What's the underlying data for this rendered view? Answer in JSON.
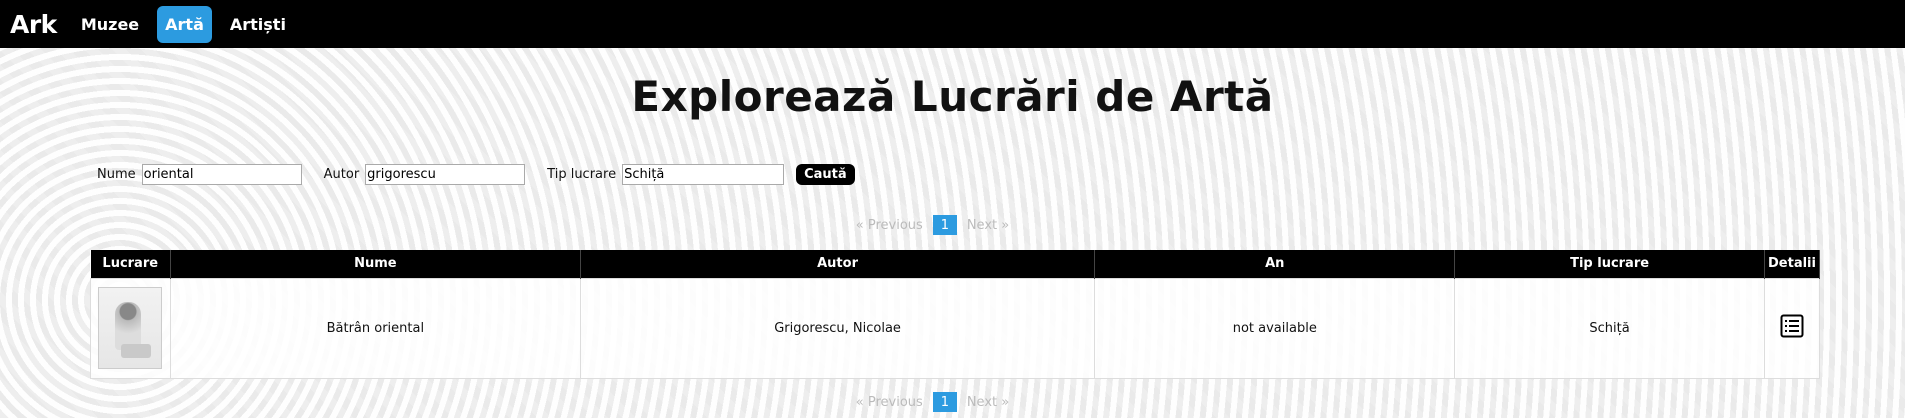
{
  "nav": {
    "brand": "Ark",
    "items": [
      {
        "label": "Muzee",
        "active": false
      },
      {
        "label": "Artă",
        "active": true
      },
      {
        "label": "Artiști",
        "active": false
      }
    ]
  },
  "page": {
    "title": "Explorează Lucrări de Artă"
  },
  "filters": {
    "name_label": "Nume",
    "name_value": "oriental",
    "author_label": "Autor",
    "author_value": "grigorescu",
    "type_label": "Tip lucrare",
    "type_value": "Schiță",
    "search_label": "Caută"
  },
  "pagination": {
    "prev_label": "Previous",
    "next_label": "Next",
    "current_page": "1"
  },
  "table": {
    "headers": [
      "Lucrare",
      "Nume",
      "Autor",
      "An",
      "Tip lucrare",
      "Detalii"
    ],
    "rows": [
      {
        "thumbnail": "artwork-thumbnail",
        "name": "Bătrân oriental",
        "author": "Grigorescu, Nicolae",
        "year": "not available",
        "type": "Schiță",
        "details_icon": "list-details-icon"
      }
    ]
  },
  "colors": {
    "accent": "#2c9be0",
    "nav_bg": "#000000"
  }
}
